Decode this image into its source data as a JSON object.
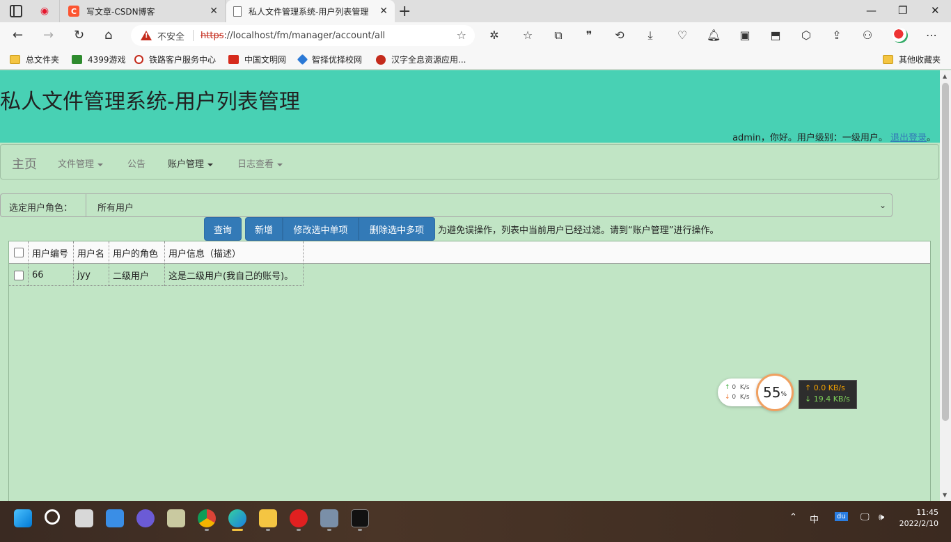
{
  "browser": {
    "tabs": [
      {
        "title": "",
        "icon": "weibo-icon"
      },
      {
        "title": "写文章-CSDN博客",
        "icon": "csdn-icon"
      },
      {
        "title": "私人文件管理系统-用户列表管理",
        "icon": "page-icon",
        "active": true
      }
    ],
    "security_label": "不安全",
    "url_scheme": "https",
    "url_rest": "://localhost/fm/manager/account/all",
    "bookmarks": [
      "总文件夹",
      "4399游戏",
      "铁路客户服务中心",
      "中国文明网",
      "智择优择校网",
      "汉字全息资源应用..."
    ],
    "other_bookmarks": "其他收藏夹"
  },
  "page": {
    "title": "私人文件管理系统-用户列表管理",
    "user_greeting": "admin，你好。用户级别：一级用户。",
    "logout": "退出登录",
    "logout_suffix": "。",
    "nav": {
      "brand": "主页",
      "items": [
        {
          "label": "文件管理",
          "dropdown": true
        },
        {
          "label": "公告",
          "dropdown": false
        },
        {
          "label": "账户管理",
          "dropdown": true,
          "active": true
        },
        {
          "label": "日志查看",
          "dropdown": true
        }
      ]
    },
    "role_filter": {
      "label": "选定用户角色：",
      "value": "所有用户"
    },
    "buttons": {
      "query": "查询",
      "add": "新增",
      "edit": "修改选中单项",
      "delete": "删除选中多项"
    },
    "hint": "为避免误操作，列表中当前用户已经过滤。请到“账户管理”进行操作。",
    "table": {
      "columns": [
        "用户编号",
        "用户名",
        "用户的角色",
        "用户信息（描述）"
      ],
      "rows": [
        {
          "id": "66",
          "name": "jyy",
          "role": "二级用户",
          "desc": "这是二级用户(我自己的账号)。"
        }
      ]
    }
  },
  "widgets": {
    "net_up": "0",
    "net_down": "0",
    "net_unit": "K/s",
    "gauge_value": "55",
    "gauge_unit": "%",
    "speed_up": "↑ 0.0 KB/s",
    "speed_down": "↓ 19.4 KB/s"
  },
  "taskbar": {
    "ime": "中",
    "time": "11:45",
    "date": "2022/2/10"
  }
}
